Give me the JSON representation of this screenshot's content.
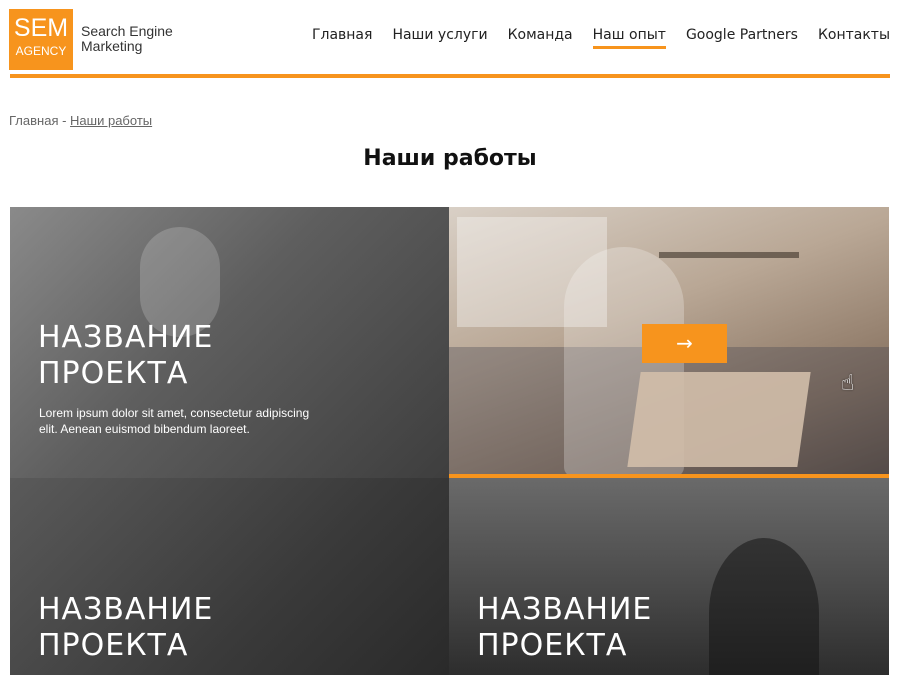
{
  "logo": {
    "line1": "SEM",
    "line2": "AGENCY"
  },
  "tagline": {
    "line1": "Search Engine",
    "line2": "Marketing"
  },
  "nav": {
    "items": [
      {
        "label": "Главная"
      },
      {
        "label": "Наши услуги"
      },
      {
        "label": "Команда"
      },
      {
        "label": "Наш опыт"
      },
      {
        "label": "Google Partners"
      },
      {
        "label": "Контакты"
      }
    ],
    "active_index": 3
  },
  "breadcrumb": {
    "home": "Главная",
    "separator": " - ",
    "current": "Наши работы"
  },
  "page_title": "Наши работы",
  "projects": [
    {
      "title_line1": "НАЗВАНИЕ",
      "title_line2": "ПРОЕКТА",
      "description": "Lorem ipsum dolor sit amet, consectetur adipiscing elit. Aenean euismod bibendum laoreet."
    },
    {
      "arrow": "→"
    },
    {
      "title_line1": "НАЗВАНИЕ",
      "title_line2": "ПРОЕКТА"
    },
    {
      "title_line1": "НАЗВАНИЕ",
      "title_line2": "ПРОЕКТА"
    }
  ],
  "colors": {
    "accent": "#f7941d"
  },
  "icons": {
    "cursor": "hand-pointer-icon"
  }
}
